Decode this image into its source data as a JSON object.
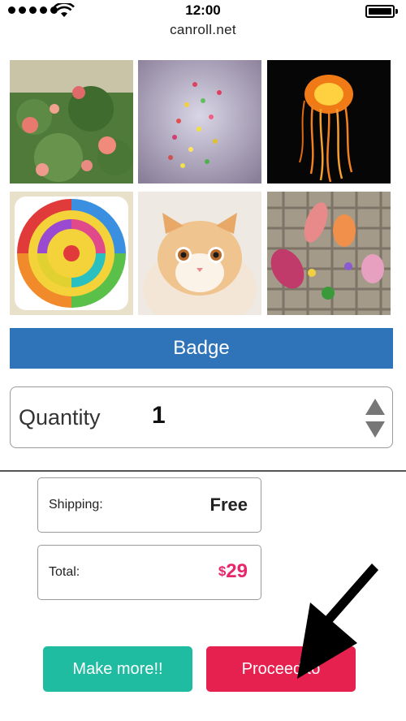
{
  "status_bar": {
    "time": "12:00",
    "url": "canroll.net",
    "signal_dots": 5,
    "icons": [
      "signal-dots-icon",
      "wifi-icon",
      "battery-icon"
    ]
  },
  "photos": [
    {
      "name": "flowers-photo",
      "subject": "pink flowers with green leaves"
    },
    {
      "name": "balloons-photo",
      "subject": "colorful balloons in sky"
    },
    {
      "name": "jellyfish-photo",
      "subject": "orange jellyfish on black"
    },
    {
      "name": "lollipop-photo",
      "subject": "rainbow swirl lollipop"
    },
    {
      "name": "cat-photo",
      "subject": "orange and white kitten"
    },
    {
      "name": "leaves-photo",
      "subject": "autumn leaves on woven mat"
    }
  ],
  "badge_button": {
    "label": "Badge"
  },
  "quantity": {
    "label": "Quantity",
    "value": "1"
  },
  "shipping": {
    "label": "Shipping:",
    "value": "Free"
  },
  "total": {
    "label": "Total:",
    "currency": "$",
    "amount": "29"
  },
  "buttons": {
    "make_more": "Make more!!",
    "proceed": "Proceed to"
  },
  "colors": {
    "badge_blue": "#2f73b8",
    "make_more_teal": "#1fbca2",
    "proceed_red": "#e6214f",
    "price_pink": "#e8266a"
  }
}
